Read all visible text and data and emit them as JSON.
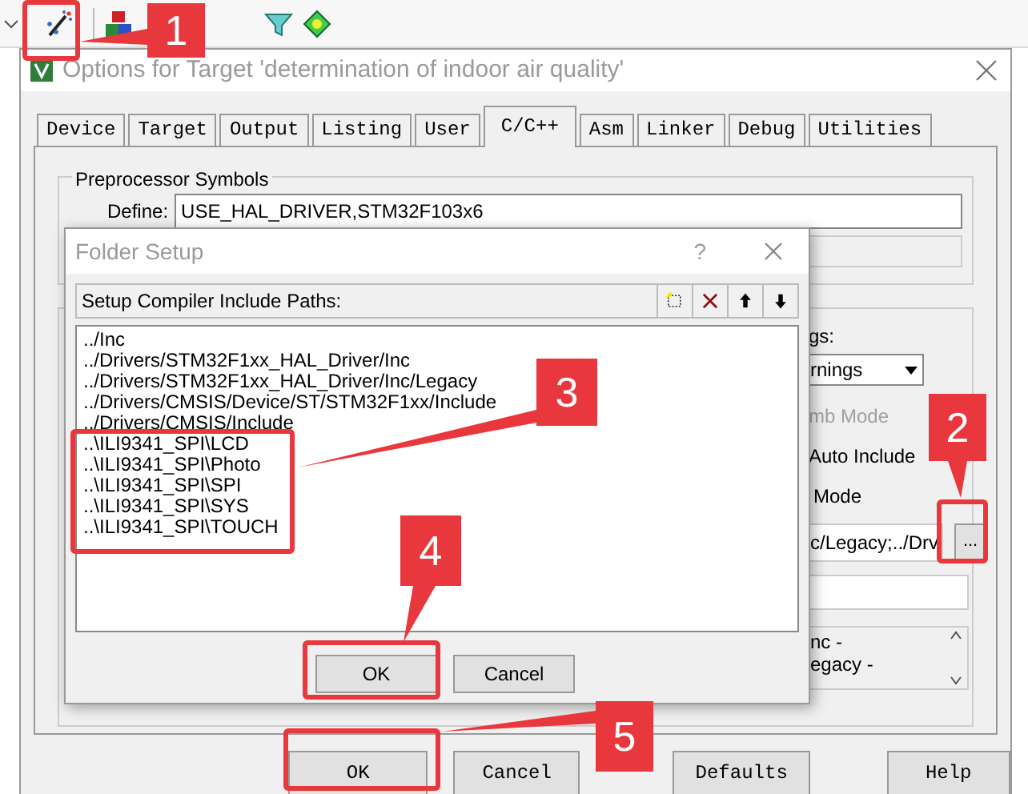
{
  "window": {
    "title": "Options for Target 'determination of indoor air quality'"
  },
  "tabs": [
    {
      "label": "Device",
      "selected": false
    },
    {
      "label": "Target",
      "selected": false
    },
    {
      "label": "Output",
      "selected": false
    },
    {
      "label": "Listing",
      "selected": false
    },
    {
      "label": "User",
      "selected": false
    },
    {
      "label": "C/C++",
      "selected": true
    },
    {
      "label": "Asm",
      "selected": false
    },
    {
      "label": "Linker",
      "selected": false
    },
    {
      "label": "Debug",
      "selected": false
    },
    {
      "label": "Utilities",
      "selected": false
    }
  ],
  "preprocessor": {
    "title": "Preprocessor Symbols",
    "define_label": "Define:",
    "define_value": "USE_HAL_DRIVER,STM32F103x6"
  },
  "partly_hidden": {
    "warnings_label": "gs:",
    "warnings_value": "rnings",
    "thumb_mode": {
      "label": "mb Mode",
      "disabled": true
    },
    "auto_include": "Auto Include",
    "mode": "Mode",
    "include_paths": "c/Legacy;../Drv",
    "browse_button": "...",
    "compiler_control": [
      "nc -",
      "egacy -"
    ]
  },
  "folder_setup": {
    "title": "Folder Setup",
    "help": "?",
    "header": "Setup Compiler Include Paths:",
    "paths": [
      "../Inc",
      "../Drivers/STM32F1xx_HAL_Driver/Inc",
      "../Drivers/STM32F1xx_HAL_Driver/Inc/Legacy",
      "../Drivers/CMSIS/Device/ST/STM32F1xx/Include",
      "../Drivers/CMSIS/Include",
      "..\\ILI9341_SPI\\LCD",
      "..\\ILI9341_SPI\\Photo",
      "..\\ILI9341_SPI\\SPI",
      "..\\ILI9341_SPI\\SYS",
      "..\\ILI9341_SPI\\TOUCH"
    ],
    "buttons": [
      "OK",
      "Cancel"
    ]
  },
  "buttons": [
    "OK",
    "Cancel",
    "Defaults",
    "Help"
  ],
  "annotations": [
    "1",
    "2",
    "3",
    "4",
    "5"
  ]
}
